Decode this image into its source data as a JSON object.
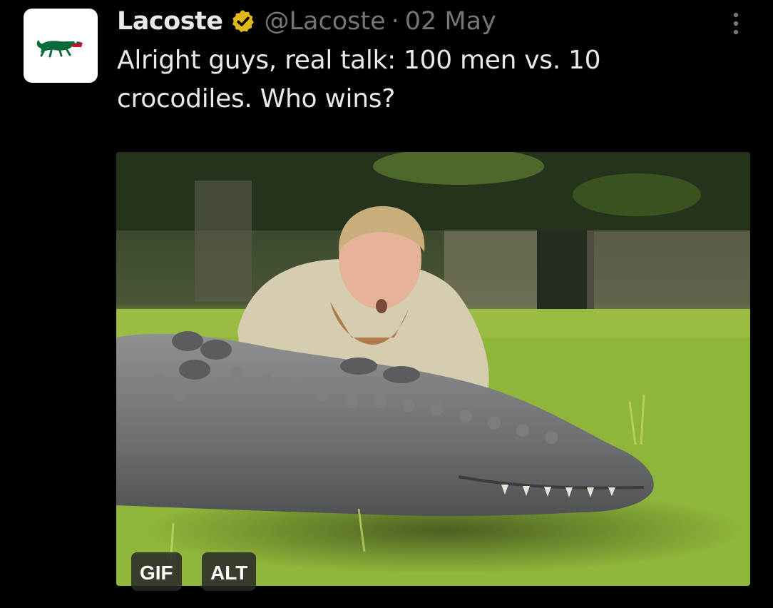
{
  "tweet": {
    "display_name": "Lacoste",
    "handle": "@Lacoste",
    "separator": "·",
    "date": "02 May",
    "text": "Alright guys, real talk: 100 men vs. 10 crocodiles. Who wins?",
    "avatar_icon": "crocodile-logo-icon",
    "verified_icon": "verified-badge-icon",
    "more_icon": "more-vertical-icon",
    "media": {
      "gif_label": "GIF",
      "alt_label": "ALT"
    }
  },
  "colors": {
    "background": "#000000",
    "text_primary": "#e7e9ea",
    "text_secondary": "#71767b",
    "verified_gold": "#e2b719",
    "lacoste_green": "#0a6b3a"
  }
}
